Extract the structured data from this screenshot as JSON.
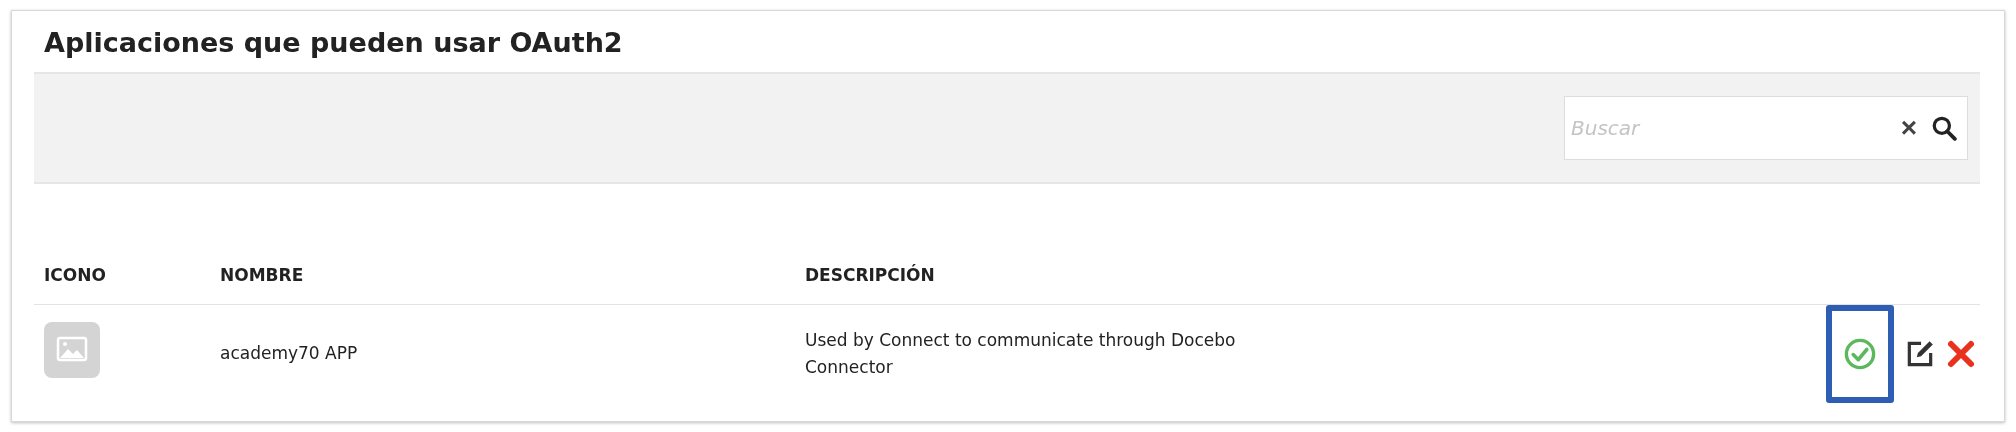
{
  "title": "Aplicaciones que pueden usar OAuth2",
  "search": {
    "placeholder": "Buscar",
    "clear": "×"
  },
  "table": {
    "columns": [
      "ICONO",
      "NOMBRE",
      "DESCRIPCIÓN"
    ],
    "rows": [
      {
        "name": "academy70 APP",
        "description": "Used by Connect to communicate through Docebo Connector",
        "active": true,
        "highlighted": true
      }
    ]
  }
}
